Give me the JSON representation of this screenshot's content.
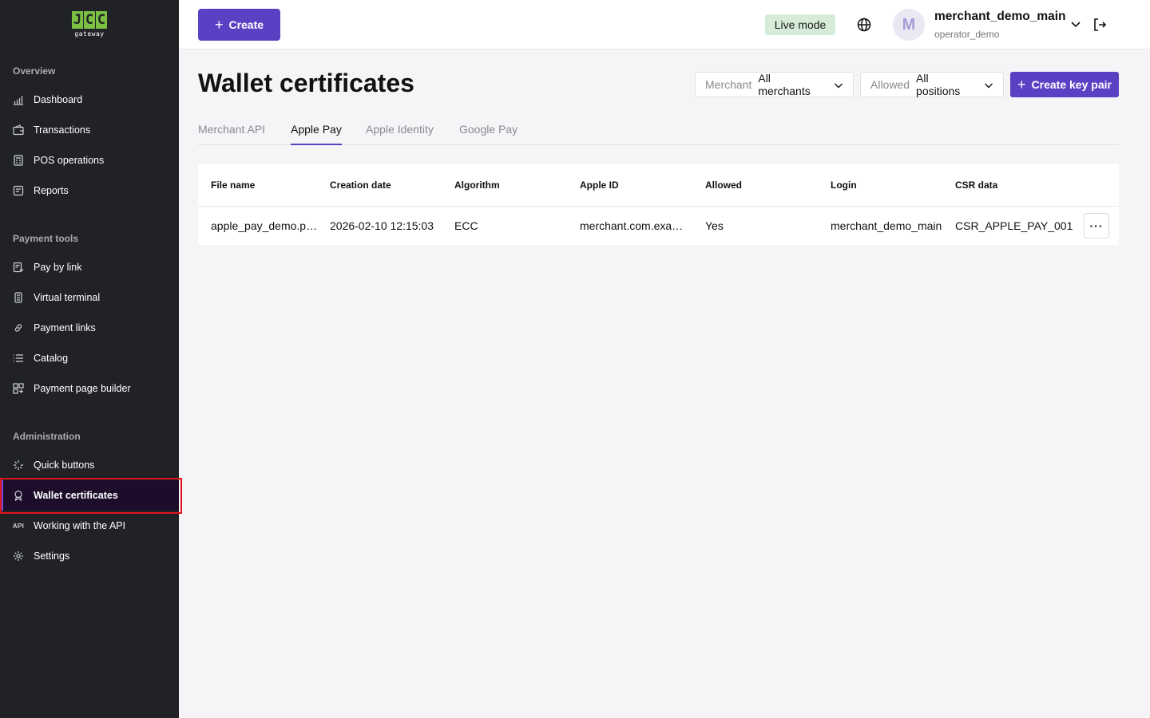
{
  "logo": {
    "mark": [
      "J",
      "C",
      "C"
    ],
    "sub": "gateway"
  },
  "sidebar": {
    "sections": [
      {
        "title": "Overview",
        "items": [
          {
            "label": "Dashboard",
            "icon": "chart-bars-icon"
          },
          {
            "label": "Transactions",
            "icon": "wallet-icon"
          },
          {
            "label": "POS operations",
            "icon": "pos-terminal-icon"
          },
          {
            "label": "Reports",
            "icon": "report-icon"
          }
        ]
      },
      {
        "title": "Payment tools",
        "items": [
          {
            "label": "Pay by link",
            "icon": "pay-link-icon"
          },
          {
            "label": "Virtual terminal",
            "icon": "virtual-terminal-icon"
          },
          {
            "label": "Payment links",
            "icon": "link-icon"
          },
          {
            "label": "Catalog",
            "icon": "list-icon"
          },
          {
            "label": "Payment page builder",
            "icon": "grid-plus-icon"
          }
        ]
      },
      {
        "title": "Administration",
        "items": [
          {
            "label": "Quick buttons",
            "icon": "sparkle-icon"
          },
          {
            "label": "Wallet certificates",
            "icon": "certificate-icon",
            "active": true
          },
          {
            "label": "Working with the API",
            "icon": "api-icon",
            "icon_text": "API"
          },
          {
            "label": "Settings",
            "icon": "gear-icon"
          }
        ]
      }
    ]
  },
  "topbar": {
    "create_label": "Create",
    "live_mode": "Live mode",
    "avatar_initial": "M",
    "user_name": "merchant_demo_main",
    "user_role": "operator_demo"
  },
  "page": {
    "title": "Wallet certificates",
    "filters": [
      {
        "label": "Merchant",
        "value": "All merchants"
      },
      {
        "label": "Allowed",
        "value": "All positions"
      }
    ],
    "create_key_pair_label": "Create key pair",
    "tabs": [
      {
        "label": "Merchant API",
        "active": false
      },
      {
        "label": "Apple Pay",
        "active": true
      },
      {
        "label": "Apple Identity",
        "active": false
      },
      {
        "label": "Google Pay",
        "active": false
      }
    ]
  },
  "table": {
    "columns": [
      "File name",
      "Creation date",
      "Algorithm",
      "Apple ID",
      "Allowed",
      "Login",
      "CSR data"
    ],
    "rows": [
      [
        "apple_pay_demo.pem",
        "2026-02-10 12:15:03",
        "ECC",
        "merchant.com.example",
        "Yes",
        "merchant_demo_main",
        "CSR_APPLE_PAY_001"
      ]
    ],
    "more_label": "···"
  },
  "colors": {
    "sidebar_bg": "#202226",
    "accent": "#5b40c4",
    "logo_green": "#7bc043",
    "live_badge_bg": "#d6ecd9",
    "active_outline": "#e0141a"
  }
}
